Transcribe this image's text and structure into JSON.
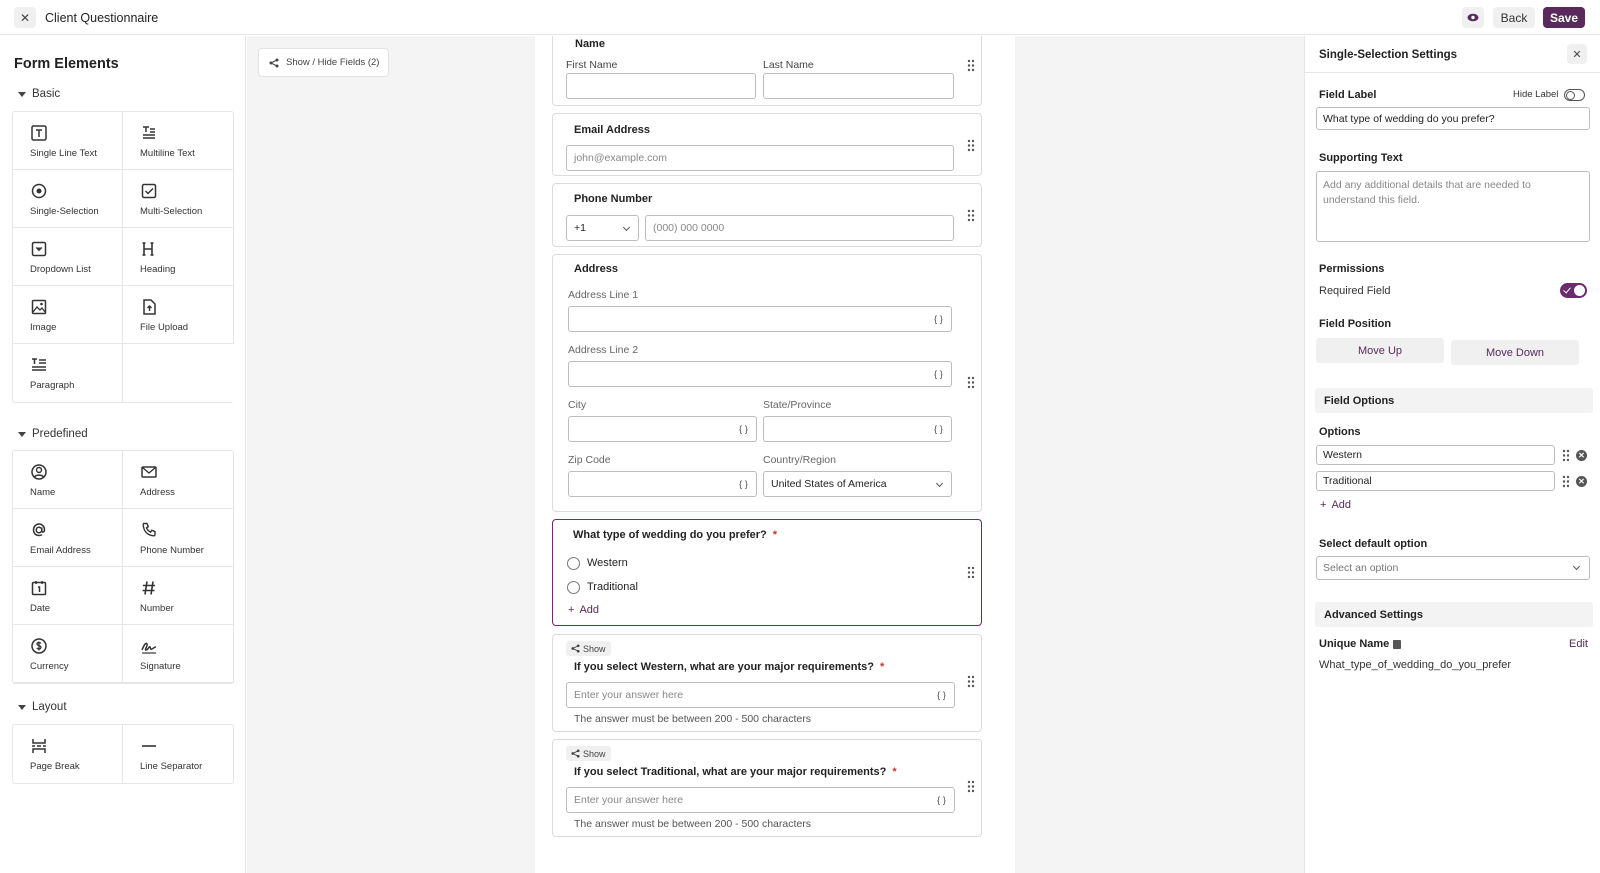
{
  "header": {
    "close_icon": "close-icon",
    "title": "Client Questionnaire",
    "preview_icon": "eye-icon",
    "back_label": "Back",
    "save_label": "Save",
    "accent_color": "#5a2a5c"
  },
  "sidebar": {
    "title": "Form Elements",
    "sections": [
      {
        "label": "Basic",
        "items": [
          {
            "label": "Single Line Text",
            "icon": "single-line-text-icon"
          },
          {
            "label": "Multiline Text",
            "icon": "multiline-text-icon"
          },
          {
            "label": "Single-Selection",
            "icon": "radio-icon"
          },
          {
            "label": "Multi-Selection",
            "icon": "checkbox-icon"
          },
          {
            "label": "Dropdown List",
            "icon": "dropdown-icon"
          },
          {
            "label": "Heading",
            "icon": "heading-icon"
          },
          {
            "label": "Image",
            "icon": "image-icon"
          },
          {
            "label": "File Upload",
            "icon": "file-upload-icon"
          },
          {
            "label": "Paragraph",
            "icon": "paragraph-icon"
          }
        ]
      },
      {
        "label": "Predefined",
        "items": [
          {
            "label": "Name",
            "icon": "user-circle-icon"
          },
          {
            "label": "Address",
            "icon": "envelope-icon"
          },
          {
            "label": "Email Address",
            "icon": "at-icon"
          },
          {
            "label": "Phone Number",
            "icon": "phone-icon"
          },
          {
            "label": "Date",
            "icon": "calendar-icon"
          },
          {
            "label": "Number",
            "icon": "hash-icon"
          },
          {
            "label": "Currency",
            "icon": "dollar-icon"
          },
          {
            "label": "Signature",
            "icon": "signature-icon"
          }
        ]
      },
      {
        "label": "Layout",
        "items": [
          {
            "label": "Page Break",
            "icon": "page-break-icon"
          },
          {
            "label": "Line Separator",
            "icon": "line-separator-icon"
          }
        ]
      }
    ]
  },
  "canvas": {
    "show_hide_label": "Show / Hide Fields (2)",
    "name_field": {
      "label": "Name",
      "first_label": "First Name",
      "last_label": "Last Name"
    },
    "email_field": {
      "label": "Email Address",
      "placeholder": "john@example.com"
    },
    "phone_field": {
      "label": "Phone Number",
      "code": "+1",
      "placeholder": "(000) 000 0000"
    },
    "address_field": {
      "label": "Address",
      "line1": "Address Line 1",
      "line2": "Address Line 2",
      "city": "City",
      "state": "State/Province",
      "zip": "Zip Code",
      "country_label": "Country/Region",
      "country_value": "United States of America",
      "brace": "{ }"
    },
    "wedding_field": {
      "label": "What type of wedding do you prefer?",
      "required_mark": "*",
      "options": [
        "Western",
        "Traditional"
      ],
      "add_label": "Add"
    },
    "conditional_fields": [
      {
        "tag": "Show",
        "label": "If you select Western, what are your major requirements?",
        "required_mark": "*",
        "placeholder": "Enter your answer here",
        "hint": "The answer must be between 200 - 500 characters",
        "brace": "{ }"
      },
      {
        "tag": "Show",
        "label": "If you select Traditional, what are your major requirements?",
        "required_mark": "*",
        "placeholder": "Enter your answer here",
        "hint": "The answer must be between 200 - 500 characters",
        "brace": "{ }"
      }
    ]
  },
  "settings": {
    "title": "Single-Selection Settings",
    "field_label": "Field Label",
    "hide_label": "Hide Label",
    "hide_label_on": false,
    "field_label_value": "What type of wedding do you prefer?",
    "supporting_text": "Supporting Text",
    "supporting_placeholder": "Add any additional details that are needed to understand this field.",
    "permissions": "Permissions",
    "required_field": "Required Field",
    "required_on": true,
    "field_position": "Field Position",
    "move_up": "Move Up",
    "move_down": "Move Down",
    "field_options": "Field Options",
    "options_label": "Options",
    "options": [
      "Western",
      "Traditional"
    ],
    "add_label": "Add",
    "default_label": "Select default option",
    "default_placeholder": "Select an option",
    "advanced": "Advanced Settings",
    "unique_name_label": "Unique Name",
    "edit_label": "Edit",
    "unique_name_value": "What_type_of_wedding_do_you_prefer"
  }
}
